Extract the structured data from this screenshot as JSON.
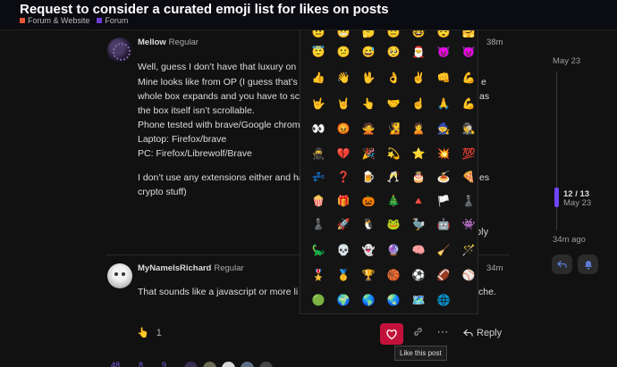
{
  "header": {
    "title": "Request to consider a curated emoji list for likes on posts",
    "categories": [
      {
        "label": "Forum & Website",
        "color": "#e45735"
      },
      {
        "label": "Forum",
        "color": "#6f3bd4"
      }
    ]
  },
  "post1": {
    "username": "Mellow",
    "user_title": "Regular",
    "time": "38m",
    "lines": [
      "Well, guess I don’t have that luxury on",
      "Mine looks like from OP (I guess that’s",
      "whole box expands and you have to sc",
      "the box itself isn’t scrollable.",
      "Phone tested with brave/Google chrom",
      "Laptop: Firefox/brave",
      "PC: Firefox/Librewolf/Brave",
      "I don’t use any extensions either and ha",
      "crypto stuff)"
    ],
    "line_tails": [
      "e",
      "as",
      "es"
    ],
    "reply_label": "Reply"
  },
  "post2": {
    "username": "MyNameIsRichard",
    "user_title": "Regular",
    "time": "34m",
    "text_start": "That sounds like a javascript or more li",
    "text_end": "che.",
    "like_count": "1",
    "reply_label": "Reply",
    "like_tooltip": "Like this post"
  },
  "emoji_rows": [
    [
      "😇",
      "😕",
      "😅",
      "🥺",
      "🎅",
      "😈",
      "👿"
    ],
    [
      "👍",
      "👋",
      "🖖",
      "👌",
      "✌️",
      "👊",
      "💪"
    ],
    [
      "🤟",
      "🤘",
      "👆",
      "🤝",
      "☝️",
      "🙏",
      "💪"
    ],
    [
      "👀",
      "😡",
      "🙅",
      "🧏",
      "🙎",
      "🧙",
      "🕵️"
    ],
    [
      "🥷",
      "💔",
      "🎉",
      "💫",
      "⭐",
      "💥",
      "💯"
    ],
    [
      "💤",
      "❓",
      "🍺",
      "🥂",
      "🎂",
      "🍝",
      "🍕"
    ],
    [
      "🍿",
      "🎁",
      "🎃",
      "🎄",
      "🔺",
      "🏳️",
      "♟️"
    ],
    [
      "♟️",
      "🚀",
      "🐧",
      "🐸",
      "🦤",
      "🤖",
      "👾"
    ],
    [
      "🦕",
      "💀",
      "👻",
      "🔮",
      "🧠",
      "🧹",
      "🪄"
    ],
    [
      "🎖️",
      "🥇",
      "🏆",
      "🏀",
      "⚽",
      "🏈",
      "⚾"
    ],
    [
      "🟢",
      "🌍",
      "🌎",
      "🌏",
      "🗺️",
      "🌐"
    ]
  ],
  "timeline": {
    "top_date": "May 23",
    "position": "12 / 13",
    "position_date": "May 23",
    "bottom_label": "34m ago"
  },
  "stats": [
    "48",
    "8",
    "9"
  ],
  "icons": {
    "like": "heart-icon",
    "link": "link-icon",
    "more": "ellipsis-icon",
    "reply": "reply-arrow-icon",
    "like_emoji": "point-up-emoji",
    "timeline_reply": "reply-arrow-icon",
    "notification": "bell-icon"
  },
  "colors": {
    "accent": "#6f45ff",
    "like_active": "#c2123a",
    "category_red": "#e45735",
    "category_purple": "#6f3bd4"
  }
}
